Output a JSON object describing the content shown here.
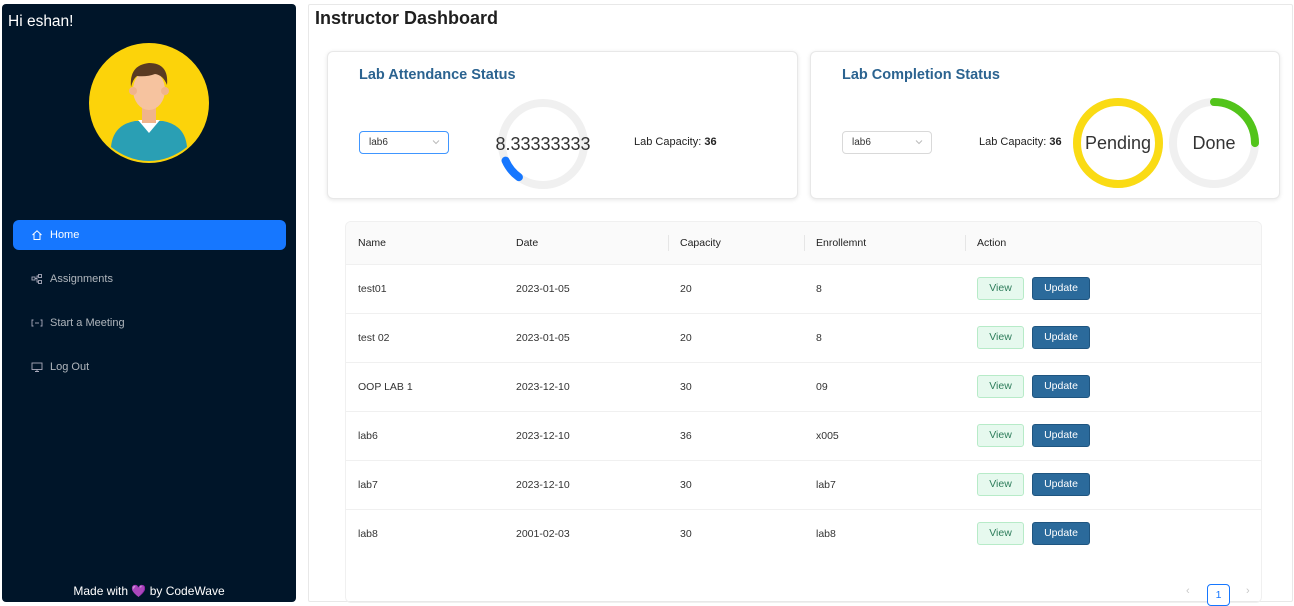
{
  "sidebar": {
    "greeting": "Hi eshan!",
    "items": [
      {
        "label": "Home",
        "icon": "home-icon",
        "active": true
      },
      {
        "label": "Assignments",
        "icon": "cluster-icon"
      },
      {
        "label": "Start a Meeting",
        "icon": "meeting-icon"
      },
      {
        "label": "Log Out",
        "icon": "desktop-icon"
      }
    ],
    "footer": {
      "prefix": "Made with",
      "heart": "💜",
      "suffix": "by CodeWave"
    }
  },
  "main": {
    "title": "Instructor Dashboard",
    "attendance": {
      "title": "Lab Attendance Status",
      "select_value": "lab6",
      "gauge_text": "8.33333333",
      "gauge_percent": 8.33333333,
      "capacity_label": "Lab Capacity:",
      "capacity_value": "36"
    },
    "completion": {
      "title": "Lab Completion Status",
      "select_value": "lab6",
      "capacity_label": "Lab Capacity:",
      "capacity_value": "36",
      "pending_label": "Pending",
      "pending_percent": 100,
      "done_label": "Done",
      "done_percent": 25
    },
    "table": {
      "columns": [
        "Name",
        "Date",
        "Capacity",
        "Enrollemnt",
        "Action"
      ],
      "rows": [
        {
          "name": "test01",
          "date": "2023-01-05",
          "capacity": "20",
          "enrollment": "8"
        },
        {
          "name": "test 02",
          "date": "2023-01-05",
          "capacity": "20",
          "enrollment": "8"
        },
        {
          "name": "OOP LAB 1",
          "date": "2023-12-10",
          "capacity": "30",
          "enrollment": "09"
        },
        {
          "name": "lab6",
          "date": "2023-12-10",
          "capacity": "36",
          "enrollment": "x005"
        },
        {
          "name": "lab7",
          "date": "2023-12-10",
          "capacity": "30",
          "enrollment": "lab7"
        },
        {
          "name": "lab8",
          "date": "2001-02-03",
          "capacity": "30",
          "enrollment": "lab8"
        }
      ],
      "view_label": "View",
      "update_label": "Update"
    },
    "pagination": {
      "current": "1",
      "prev": "‹",
      "next": "›"
    }
  },
  "colors": {
    "sidebar_bg": "#001529",
    "accent": "#1677ff",
    "pending": "#fadb14",
    "done": "#52c41a",
    "update_btn": "#2b6a9b"
  }
}
